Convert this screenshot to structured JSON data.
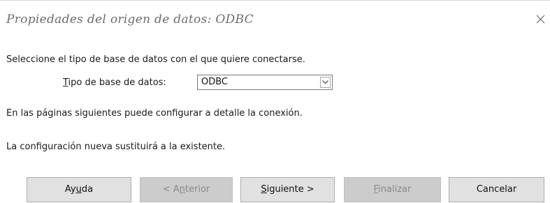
{
  "window": {
    "title": "Propiedades del origen de datos: ODBC",
    "close_icon": "close-icon"
  },
  "content": {
    "intro": "Seleccione el tipo de base de datos con el que quiere conectarse.",
    "dbtype_label_mnemonic": "T",
    "dbtype_label_rest": "ipo de base de datos:",
    "dbtype_value": "ODBC",
    "info_pages": "En las páginas siguientes puede configurar a detalle la conexión.",
    "info_replace": "La configuración nueva sustituirá a la existente."
  },
  "buttons": {
    "help": {
      "pre": "Ay",
      "mnemonic": "u",
      "post": "da"
    },
    "back": {
      "pre": "< A",
      "mnemonic": "n",
      "post": "terior",
      "enabled": false
    },
    "next": {
      "pre": "",
      "mnemonic": "S",
      "post": "iguiente >"
    },
    "finish": {
      "pre": "",
      "mnemonic": "F",
      "post": "inalizar",
      "enabled": false
    },
    "cancel": {
      "pre": "Cancelar",
      "mnemonic": "",
      "post": ""
    }
  },
  "colors": {
    "button_bg": "#e1e1e1",
    "button_disabled_bg": "#cccccc",
    "title_text": "#6d6d6d"
  }
}
